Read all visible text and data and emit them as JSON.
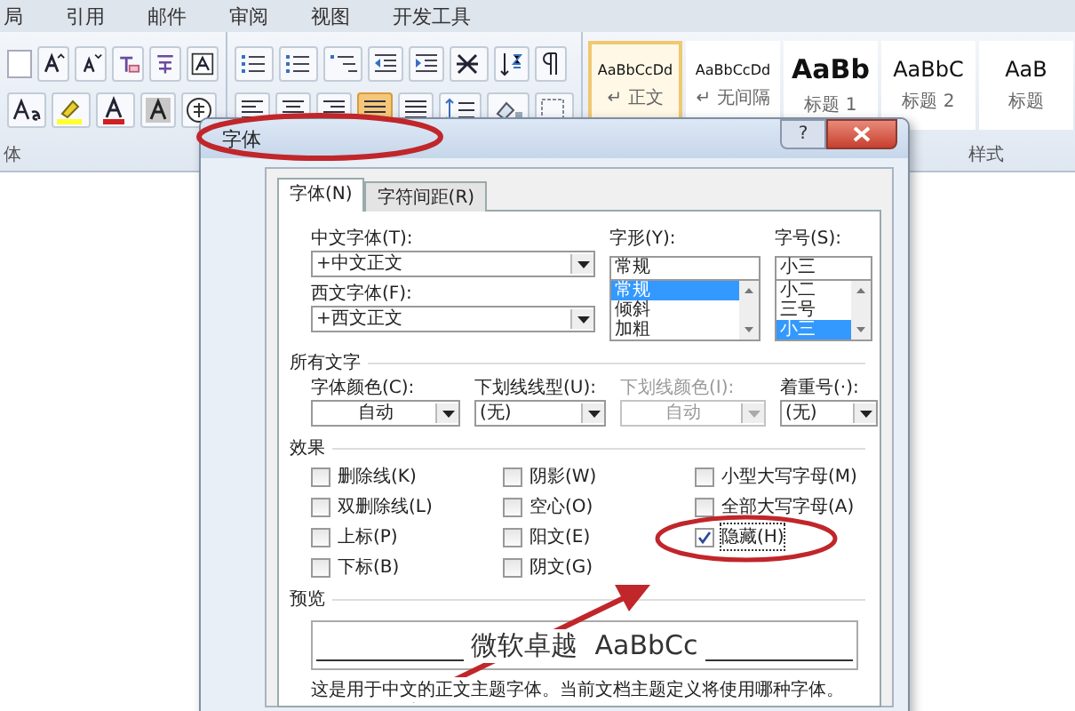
{
  "ribbon_tabs": [
    "局",
    "引用",
    "邮件",
    "审阅",
    "视图",
    "开发工具"
  ],
  "ribbon": {
    "font_group_label": "体",
    "styles_group_label": "样式",
    "styles": [
      {
        "preview": "AaBbCcDd",
        "name": "↵ 正文",
        "kind": "body",
        "selected": true
      },
      {
        "preview": "AaBbCcDd",
        "name": "↵ 无间隔",
        "kind": "body",
        "selected": false
      },
      {
        "preview": "AaBb",
        "name": "标题 1",
        "kind": "heading1",
        "selected": false
      },
      {
        "preview": "AaBbC",
        "name": "标题 2",
        "kind": "heading2",
        "selected": false
      },
      {
        "preview": "AaB",
        "name": "标题",
        "kind": "heading2",
        "selected": false
      }
    ]
  },
  "dialog": {
    "title": "字体",
    "help": "?",
    "tabs": [
      {
        "label": "字体(N)",
        "selected": true
      },
      {
        "label": "字符间距(R)",
        "selected": false
      }
    ],
    "chinese_font": {
      "label": "中文字体(T):",
      "value": "+中文正文"
    },
    "western_font": {
      "label": "西文字体(F):",
      "value": "+西文正文"
    },
    "style": {
      "label": "字形(Y):",
      "value": "常规",
      "options": [
        {
          "label": "常规",
          "selected": true
        },
        {
          "label": "倾斜",
          "selected": false
        },
        {
          "label": "加粗",
          "selected": false
        }
      ]
    },
    "size": {
      "label": "字号(S):",
      "value": "小三",
      "options": [
        {
          "label": "小二",
          "selected": false
        },
        {
          "label": "三号",
          "selected": false
        },
        {
          "label": "小三",
          "selected": true
        }
      ]
    },
    "all_text_label": "所有文字",
    "dropdowns": [
      {
        "label": "字体颜色(C):",
        "value": "自动",
        "disabled": false,
        "centered": true
      },
      {
        "label": "下划线线型(U):",
        "value": "(无)",
        "disabled": false,
        "centered": false
      },
      {
        "label": "下划线颜色(I):",
        "value": "自动",
        "disabled": true,
        "centered": true
      },
      {
        "label": "着重号(·):",
        "value": "(无)",
        "disabled": false,
        "centered": false
      }
    ],
    "effects_label": "效果",
    "effects": [
      [
        {
          "label": "删除线(K)",
          "checked": false
        },
        {
          "label": "双删除线(L)",
          "checked": false
        },
        {
          "label": "上标(P)",
          "checked": false
        },
        {
          "label": "下标(B)",
          "checked": false
        }
      ],
      [
        {
          "label": "阴影(W)",
          "checked": false
        },
        {
          "label": "空心(O)",
          "checked": false
        },
        {
          "label": "阳文(E)",
          "checked": false
        },
        {
          "label": "阴文(G)",
          "checked": false
        }
      ],
      [
        {
          "label": "小型大写字母(M)",
          "checked": false
        },
        {
          "label": "全部大写字母(A)",
          "checked": false
        },
        {
          "label": "隐藏(H)",
          "checked": true
        }
      ]
    ],
    "preview_label": "预览",
    "preview_sample": "微软卓越  AaBbCc",
    "note": "这是用于中文的正文主题字体。当前文档主题定义将使用哪种字体。"
  }
}
